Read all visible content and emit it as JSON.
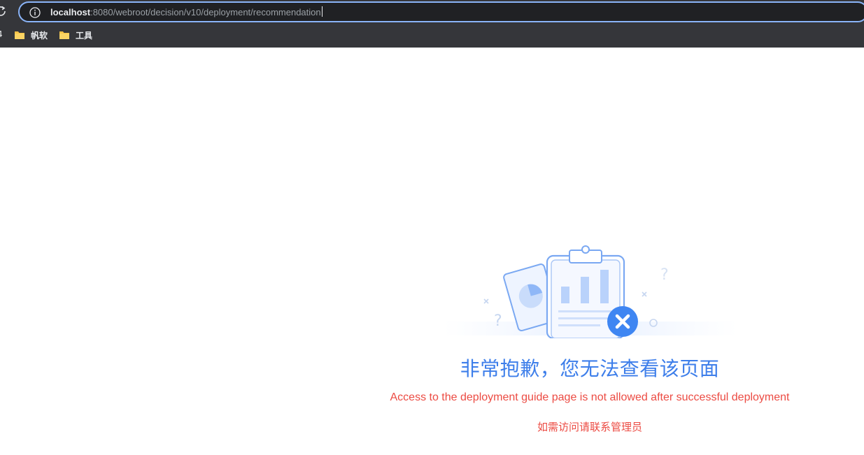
{
  "browser": {
    "url_host": "localhost",
    "url_rest": ":8080/webroot/decision/v10/deployment/recommendation",
    "bookmarks": [
      {
        "label": "帆软"
      },
      {
        "label": "工具"
      }
    ],
    "bookmark_edge": "4"
  },
  "error_page": {
    "title": "非常抱歉，您无法查看该页面",
    "description": "Access to the deployment guide page is not allowed after successful deployment",
    "contact": "如需访问请联系管理员"
  },
  "colors": {
    "title": "#3d7eea",
    "message": "#ec4b43",
    "chrome": "#35363a",
    "omnibox": "#202124"
  }
}
